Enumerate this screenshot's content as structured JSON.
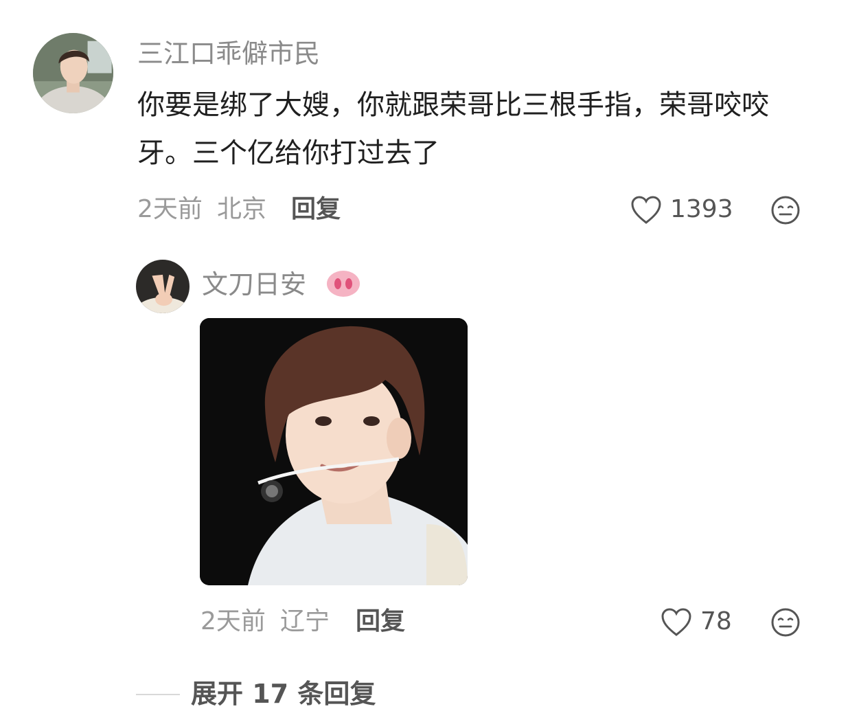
{
  "comment": {
    "username": "三江口乖僻市民",
    "text": "你要是绑了大嫂，你就跟荣哥比三根手指，荣哥咬咬牙。三个亿给你打过去了",
    "time": "2天前",
    "location": "北京",
    "reply_label": "回复",
    "like_count": "1393",
    "avatar_icon": "user-avatar-photo",
    "like_icon": "heart-outline-icon",
    "reaction_icon": "face-emoji-icon"
  },
  "reply": {
    "username": "文刀日安",
    "badge_icon": "pig-nose-emoji",
    "image_icon": "reply-photo-singer",
    "time": "2天前",
    "location": "辽宁",
    "reply_label": "回复",
    "like_count": "78",
    "like_icon": "heart-outline-icon",
    "reaction_icon": "face-emoji-icon"
  },
  "expand": {
    "label": "展开 17 条回复"
  },
  "colors": {
    "username": "#8a8a8a",
    "text": "#1f1f1f",
    "meta": "#9a9a9a",
    "action": "#555555",
    "badge": "#f3a0b4"
  }
}
